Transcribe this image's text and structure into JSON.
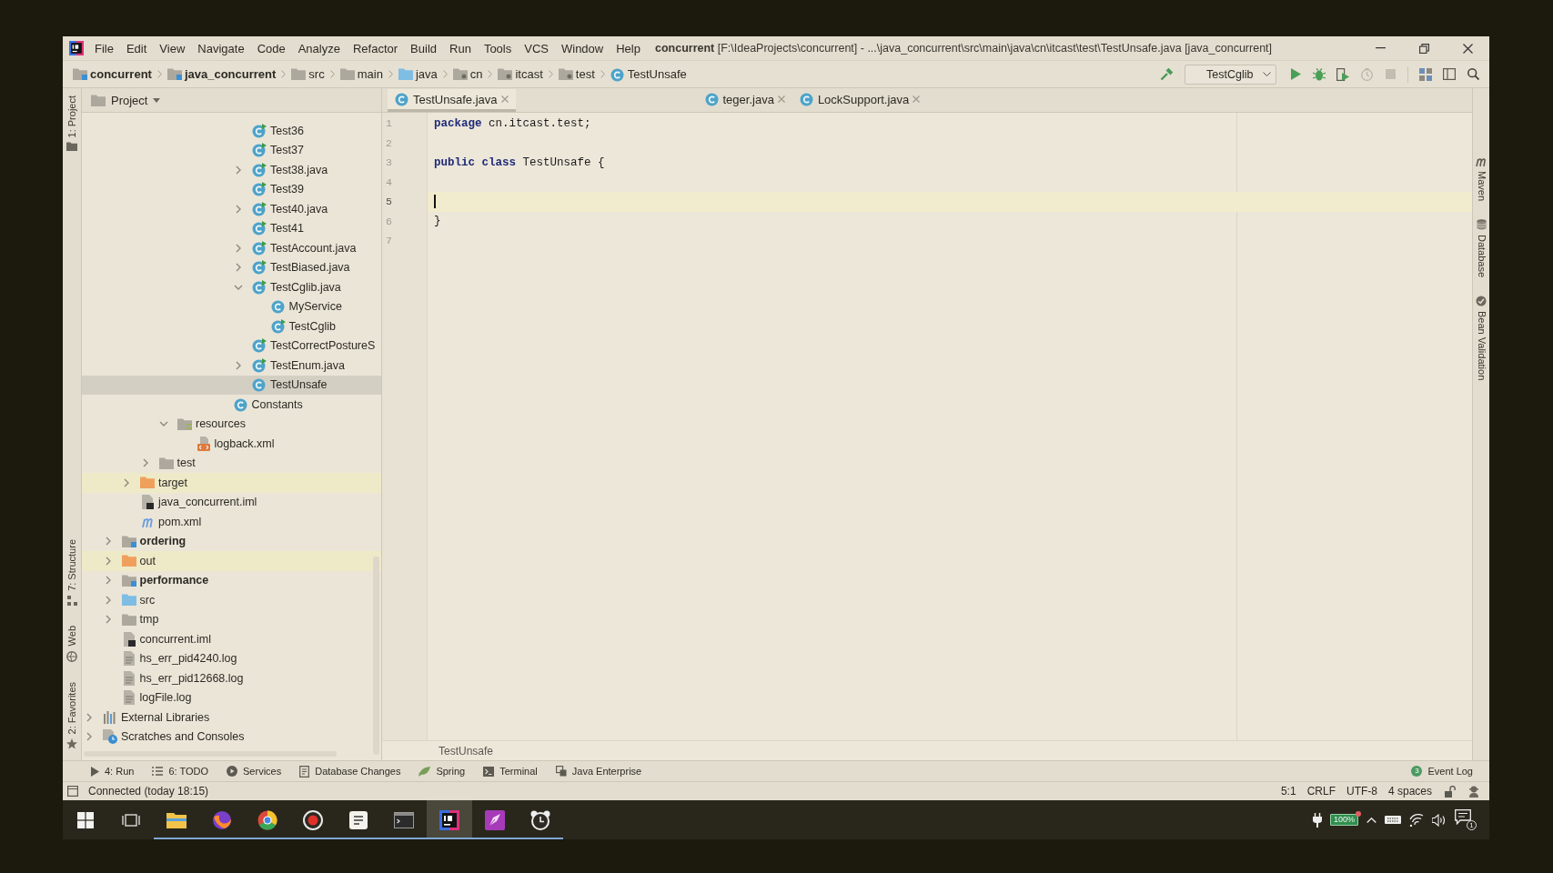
{
  "title_bar": {
    "menu": [
      "File",
      "Edit",
      "View",
      "Navigate",
      "Code",
      "Analyze",
      "Refactor",
      "Build",
      "Run",
      "Tools",
      "VCS",
      "Window",
      "Help"
    ],
    "title": "**concurrent** [F:\\IdeaProjects\\concurrent] - ...\\java_concurrent\\src\\main\\java\\cn\\itcast\\test\\TestUnsafe.java [java_concurrent]"
  },
  "nav_bar": {
    "crumbs": [
      {
        "label": "concurrent",
        "kind": "module"
      },
      {
        "label": "java_concurrent",
        "kind": "module"
      },
      {
        "label": "src",
        "kind": "folder"
      },
      {
        "label": "main",
        "kind": "folder"
      },
      {
        "label": "java",
        "kind": "source_folder"
      },
      {
        "label": "cn",
        "kind": "package"
      },
      {
        "label": "itcast",
        "kind": "package"
      },
      {
        "label": "test",
        "kind": "package"
      },
      {
        "label": "TestUnsafe",
        "kind": "class"
      }
    ],
    "run_config": "TestCglib"
  },
  "left_tool_strip": {
    "top": [
      {
        "label": "1: Project",
        "kind": "project"
      }
    ],
    "bottom": [
      {
        "label": "7: Structure",
        "kind": "structure"
      },
      {
        "label": "Web",
        "kind": "web"
      },
      {
        "label": "2: Favorites",
        "kind": "favorites"
      }
    ]
  },
  "project_panel": {
    "view": "Project"
  },
  "project_tree": [
    {
      "children": [
        {
          "children": [
            {
              "children": [
                {
                  "children": [
                    {
                      "children": [
                        {
                          "children": [
                            {
                              "children": [
                                {
                                  "children": [
                                    {
                                      "label": "Test36",
                                      "kind": "runnable_class",
                                      "selected": false,
                                      "highlighted": false
                                    },
                                    {
                                      "label": "Test37",
                                      "kind": "runnable_class",
                                      "selected": false,
                                      "highlighted": false
                                    },
                                    {
                                      "label": "Test38.java",
                                      "kind": "runnable_class",
                                      "selected": false,
                                      "highlighted": false,
                                      "expanded": false
                                    },
                                    {
                                      "label": "Test39",
                                      "kind": "runnable_class",
                                      "selected": false,
                                      "highlighted": false
                                    },
                                    {
                                      "label": "Test40.java",
                                      "kind": "runnable_class",
                                      "selected": false,
                                      "highlighted": false,
                                      "expanded": false
                                    },
                                    {
                                      "label": "Test41",
                                      "kind": "runnable_class",
                                      "selected": false,
                                      "highlighted": false
                                    },
                                    {
                                      "label": "TestAccount.java",
                                      "kind": "runnable_class",
                                      "selected": false,
                                      "highlighted": false,
                                      "expanded": false
                                    },
                                    {
                                      "label": "TestBiased.java",
                                      "kind": "runnable_class",
                                      "selected": false,
                                      "highlighted": false,
                                      "expanded": false
                                    },
                                    {
                                      "label": "TestCglib.java",
                                      "kind": "runnable_class",
                                      "selected": false,
                                      "highlighted": false,
                                      "expanded": true,
                                      "children": [
                                        {
                                          "label": "MyService",
                                          "kind": "class",
                                          "selected": false,
                                          "highlighted": false
                                        },
                                        {
                                          "label": "TestCglib",
                                          "kind": "runnable_class",
                                          "selected": false,
                                          "highlighted": false
                                        }
                                      ]
                                    },
                                    {
                                      "label": "TestCorrectPostureS",
                                      "kind": "runnable_class",
                                      "selected": false,
                                      "highlighted": false
                                    },
                                    {
                                      "label": "TestEnum.java",
                                      "kind": "runnable_class",
                                      "selected": false,
                                      "highlighted": false,
                                      "expanded": false
                                    },
                                    {
                                      "label": "TestUnsafe",
                                      "kind": "class",
                                      "selected": true,
                                      "highlighted": false
                                    }
                                  ]
                                },
                                {
                                  "label": "Constants",
                                  "kind": "class",
                                  "selected": false,
                                  "highlighted": false
                                }
                              ]
                            }
                          ]
                        }
                      ]
                    },
                    {
                      "label": "resources",
                      "kind": "resource_folder",
                      "selected": false,
                      "highlighted": false,
                      "expanded": true,
                      "children": [
                        {
                          "label": "logback.xml",
                          "kind": "xml",
                          "selected": false,
                          "highlighted": false
                        }
                      ]
                    }
                  ]
                },
                {
                  "label": "test",
                  "kind": "folder",
                  "selected": false,
                  "highlighted": false,
                  "expanded": false
                }
              ]
            },
            {
              "label": "target",
              "kind": "excluded_folder",
              "selected": false,
              "highlighted": true,
              "expanded": false
            },
            {
              "label": "java_concurrent.iml",
              "kind": "iml",
              "selected": false,
              "highlighted": false
            },
            {
              "label": "pom.xml",
              "kind": "maven",
              "selected": false,
              "highlighted": false
            }
          ]
        },
        {
          "label": "ordering",
          "kind": "module",
          "selected": false,
          "highlighted": false,
          "expanded": false
        },
        {
          "label": "out",
          "kind": "excluded_folder",
          "selected": false,
          "highlighted": true,
          "expanded": false
        },
        {
          "label": "performance",
          "kind": "module",
          "selected": false,
          "highlighted": false,
          "expanded": false
        },
        {
          "label": "src",
          "kind": "source_folder",
          "selected": false,
          "highlighted": false,
          "expanded": false
        },
        {
          "label": "tmp",
          "kind": "folder",
          "selected": false,
          "highlighted": false,
          "expanded": false
        },
        {
          "label": "concurrent.iml",
          "kind": "iml",
          "selected": false,
          "highlighted": false
        },
        {
          "label": "hs_err_pid4240.log",
          "kind": "text_file",
          "selected": false,
          "highlighted": false
        },
        {
          "label": "hs_err_pid12668.log",
          "kind": "text_file",
          "selected": false,
          "highlighted": false
        },
        {
          "label": "logFile.log",
          "kind": "text_file",
          "selected": false,
          "highlighted": false
        }
      ]
    },
    {
      "label": "External Libraries",
      "kind": "libraries",
      "selected": false,
      "highlighted": false,
      "expanded": false
    },
    {
      "label": "Scratches and Consoles",
      "kind": "scratches",
      "selected": false,
      "highlighted": false,
      "expanded": false
    }
  ],
  "editor": {
    "tabs": [
      {
        "label": "TestUnsafe.java",
        "selected": true,
        "closable": true
      },
      {
        "label": "teger.java",
        "selected": false,
        "closable": true
      },
      {
        "label": "LockSupport.java",
        "selected": false,
        "closable": true
      }
    ],
    "lines": [
      {
        "number": "1",
        "current": false,
        "tokens": [
          {
            "kind": "keyword",
            "text": "package"
          },
          {
            "kind": "plain",
            "text": " cn.itcast.test;"
          }
        ]
      },
      {
        "number": "2",
        "current": false
      },
      {
        "number": "3",
        "current": false,
        "tokens": [
          {
            "kind": "keyword",
            "text": "public class"
          },
          {
            "kind": "plain",
            "text": " TestUnsafe {"
          }
        ]
      },
      {
        "number": "4",
        "current": false
      },
      {
        "number": "5",
        "current": true
      },
      {
        "number": "6",
        "current": false,
        "tokens": [
          {
            "kind": "plain",
            "text": "}"
          }
        ]
      },
      {
        "number": "7",
        "current": false
      }
    ],
    "breadcrumb": "TestUnsafe"
  },
  "right_tool_strip": [
    {
      "label": "Maven",
      "kind": "maven"
    },
    {
      "label": "Database",
      "kind": "database"
    },
    {
      "label": "Bean Validation",
      "kind": "bean_validation"
    }
  ],
  "tool_windows": [
    {
      "label": "4: Run",
      "kind": "run"
    },
    {
      "label": "6: TODO",
      "kind": "todo"
    },
    {
      "label": "Services",
      "kind": "services"
    },
    {
      "label": "Database Changes",
      "kind": "database_changes"
    },
    {
      "label": "Spring",
      "kind": "spring"
    },
    {
      "label": "Terminal",
      "kind": "terminal"
    },
    {
      "label": "Java Enterprise",
      "kind": "java_enterprise"
    }
  ],
  "event_log": {
    "label": "Event Log",
    "badge": "3"
  },
  "status_bar": {
    "message": "Connected (today 18:15)",
    "items": [
      "5:1",
      "CRLF",
      "UTF-8",
      "4 spaces"
    ]
  },
  "taskbar": {
    "apps": [
      {
        "kind": "folder",
        "running": true,
        "selected": false
      },
      {
        "kind": "fox_browser",
        "running": true,
        "selected": false
      },
      {
        "kind": "round_browser",
        "running": true,
        "selected": false
      },
      {
        "kind": "recorder",
        "running": true,
        "selected": false
      },
      {
        "kind": "text_editor",
        "running": true,
        "selected": false
      },
      {
        "kind": "console",
        "running": true,
        "selected": false
      },
      {
        "kind": "ide",
        "running": true,
        "selected": true
      },
      {
        "kind": "pen",
        "running": true,
        "selected": false
      },
      {
        "kind": "clock",
        "running": true,
        "selected": false
      }
    ],
    "battery": "100%",
    "notifications": "1"
  }
}
